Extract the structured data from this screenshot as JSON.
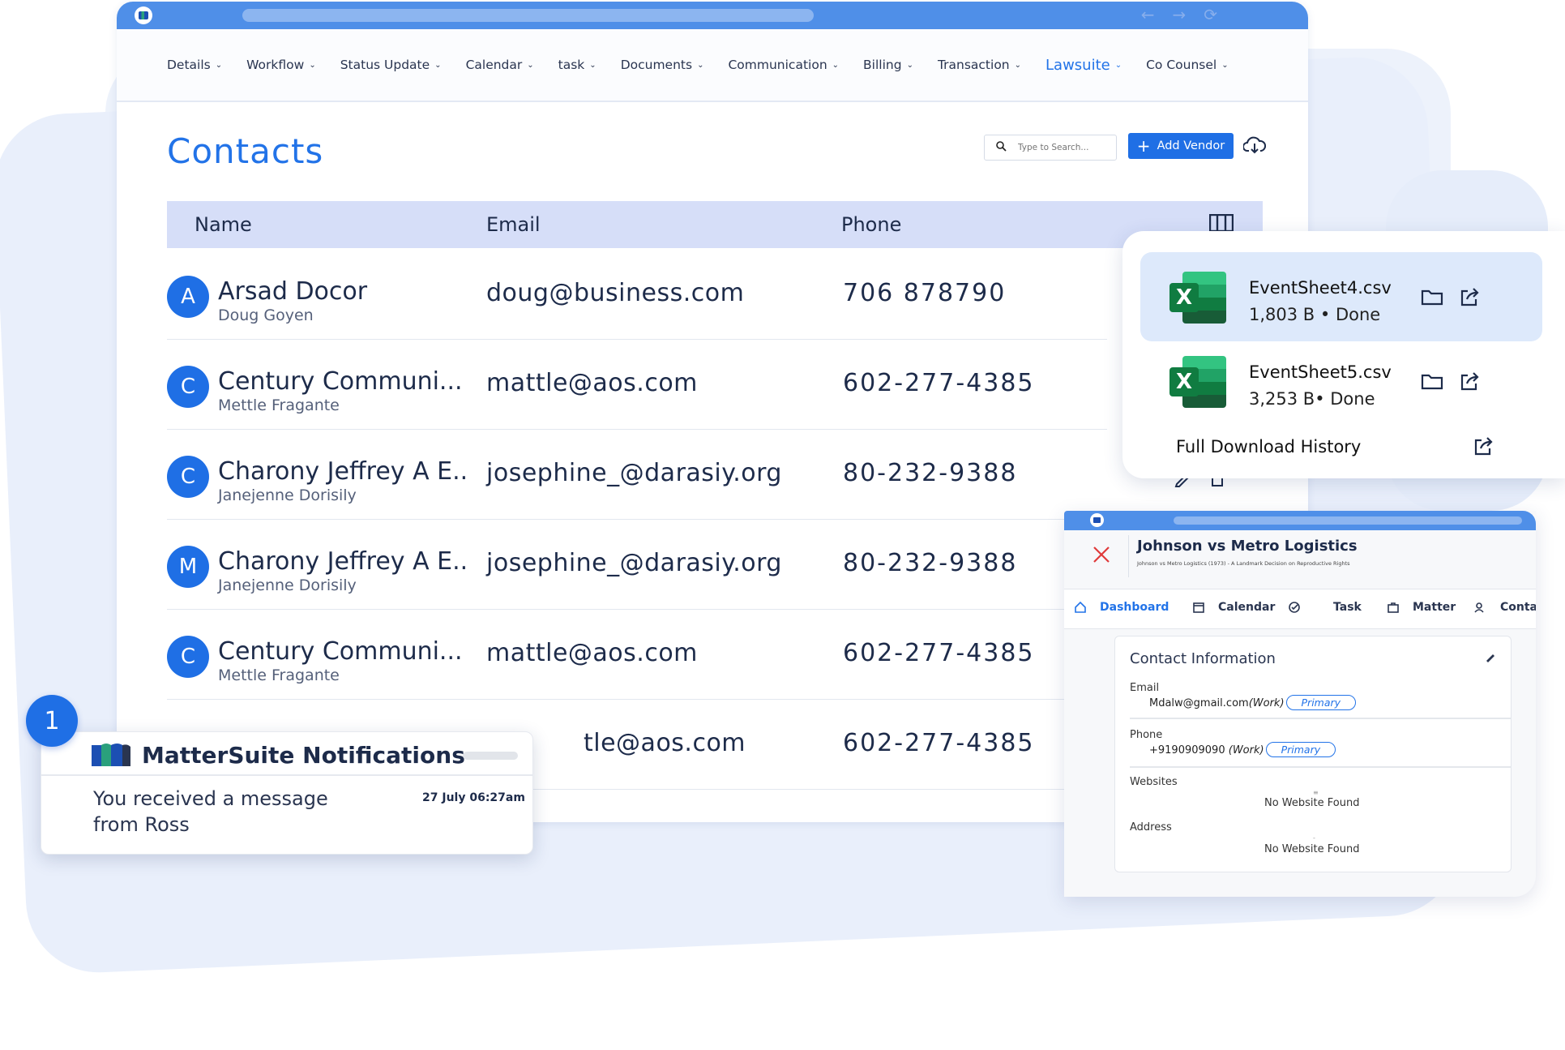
{
  "menu": [
    "Details",
    "Workflow",
    "Status Update",
    "Calendar",
    "task",
    "Documents",
    "Communication",
    "Billing",
    "Transaction",
    "Lawsuite",
    "Co Counsel"
  ],
  "menu_active": "Lawsuite",
  "page": {
    "title": "Contacts"
  },
  "search": {
    "placeholder": "Type to Search..."
  },
  "add_vendor_label": "Add Vendor",
  "table": {
    "headers": {
      "name": "Name",
      "email": "Email",
      "phone": "Phone"
    },
    "rows": [
      {
        "initial": "A",
        "name": "Arsad Docor",
        "sub": "Doug Goyen",
        "email": "doug@business.com",
        "phone": "706 878790"
      },
      {
        "initial": "C",
        "name": "Century Communi...",
        "sub": "Mettle Fragante",
        "email": "mattle@aos.com",
        "phone": "602-277-4385"
      },
      {
        "initial": "C",
        "name": "Charony Jeffrey A E..",
        "sub": "Janejenne Dorisily",
        "email": "josephine_@darasiy.org",
        "phone": "80-232-9388"
      },
      {
        "initial": "M",
        "name": "Charony Jeffrey A E..",
        "sub": "Janejenne Dorisily",
        "email": "josephine_@darasiy.org",
        "phone": "80-232-9388"
      },
      {
        "initial": "C",
        "name": "Century Communi...",
        "sub": "Mettle Fragante",
        "email": "mattle@aos.com",
        "phone": "602-277-4385"
      },
      {
        "initial": "",
        "name": "",
        "sub": "",
        "email": "tle@aos.com",
        "phone": "602-277-4385"
      }
    ]
  },
  "downloads": {
    "items": [
      {
        "name": "EventSheet4.csv",
        "meta": "1,803 B • Done"
      },
      {
        "name": "EventSheet5.csv",
        "meta": "3,253 B• Done"
      }
    ],
    "history_label": "Full Download History"
  },
  "matter": {
    "title": "Johnson vs Metro Logistics",
    "subtitle": "Johnson vs Metro Logistics (1973) - A Landmark Decision on Reproductive Rights",
    "tabs": [
      "Dashboard",
      "Calendar",
      "Task",
      "Matter",
      "Conta"
    ],
    "card": {
      "title": "Contact Information",
      "email_label": "Email",
      "email_value": "Mdalw@gmail.com",
      "email_type": "(Work)",
      "email_badge": "Primary",
      "phone_label": "Phone",
      "phone_value": "+9190909090",
      "phone_type": "(Work)",
      "phone_badge": "Primary",
      "websites_label": "Websites",
      "websites_value": "No Website Found",
      "address_label": "Address",
      "address_value": "No Website Found"
    }
  },
  "notification": {
    "badge_count": "1",
    "title": "MatterSuite Notifications",
    "message": "You received a message from Ross",
    "time": "27 July 06:27am"
  },
  "colors": {
    "accent": "#1f6fe5",
    "header_bg": "#d6def8",
    "titlebar": "#4f8fe8",
    "excel": "#107c41"
  }
}
